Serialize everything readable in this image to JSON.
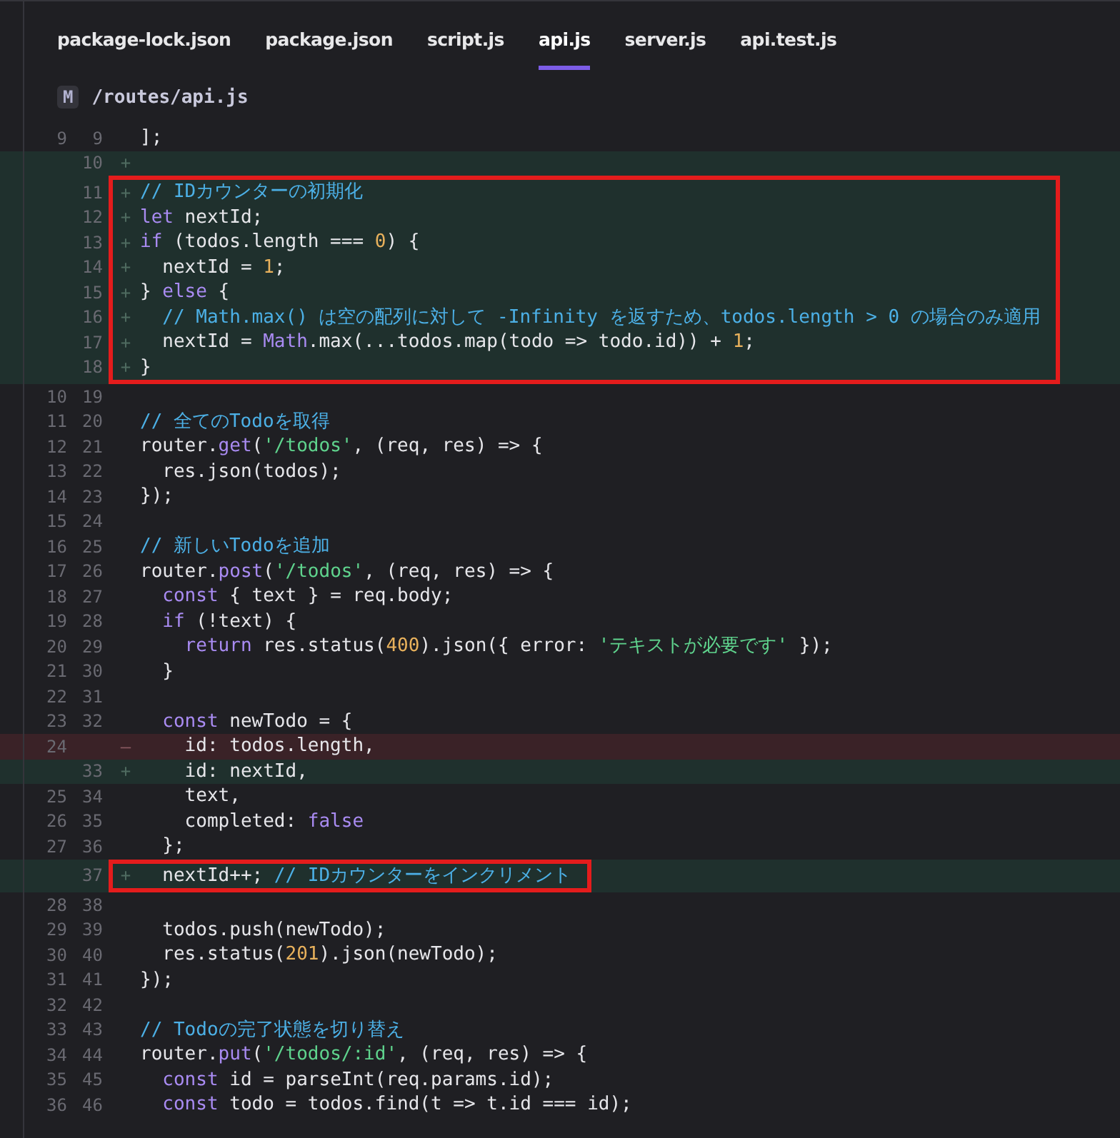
{
  "tabs": [
    {
      "label": "package-lock.json",
      "selected": false
    },
    {
      "label": "package.json",
      "selected": false
    },
    {
      "label": "script.js",
      "selected": false
    },
    {
      "label": "api.js",
      "selected": true
    },
    {
      "label": "server.js",
      "selected": false
    },
    {
      "label": "api.test.js",
      "selected": false
    }
  ],
  "file": {
    "status": "M",
    "path": "/routes/api.js"
  },
  "blocks": [
    {
      "boxed": false,
      "lines": [
        {
          "kind": "context",
          "old": "9",
          "new": "9",
          "tokens": [
            {
              "kind": "plain",
              "text": "];"
            }
          ]
        },
        {
          "kind": "added",
          "new": "10",
          "marker": "+"
        }
      ]
    },
    {
      "boxed": true,
      "lines": [
        {
          "kind": "added",
          "new": "11",
          "marker": "+",
          "tokens": [
            {
              "kind": "comment",
              "text": "// IDカウンターの初期化"
            }
          ]
        },
        {
          "kind": "added",
          "new": "12",
          "marker": "+",
          "tokens": [
            {
              "kind": "keyword",
              "text": "let"
            },
            {
              "kind": "plain",
              "text": " nextId;"
            }
          ]
        },
        {
          "kind": "added",
          "new": "13",
          "marker": "+",
          "tokens": [
            {
              "kind": "keyword",
              "text": "if"
            },
            {
              "kind": "plain",
              "text": " (todos.length === "
            },
            {
              "kind": "number",
              "text": "0"
            },
            {
              "kind": "plain",
              "text": ") {"
            }
          ]
        },
        {
          "kind": "added",
          "new": "14",
          "marker": "+",
          "tokens": [
            {
              "kind": "plain",
              "text": "  nextId = "
            },
            {
              "kind": "number",
              "text": "1"
            },
            {
              "kind": "plain",
              "text": ";"
            }
          ]
        },
        {
          "kind": "added",
          "new": "15",
          "marker": "+",
          "tokens": [
            {
              "kind": "plain",
              "text": "} "
            },
            {
              "kind": "keyword",
              "text": "else"
            },
            {
              "kind": "plain",
              "text": " {"
            }
          ]
        },
        {
          "kind": "added",
          "new": "16",
          "marker": "+",
          "tokens": [
            {
              "kind": "comment",
              "text": "  // Math.max() は空の配列に対して -Infinity を返すため、todos.length > 0 の場合のみ適用"
            }
          ]
        },
        {
          "kind": "added",
          "new": "17",
          "marker": "+",
          "tokens": [
            {
              "kind": "plain",
              "text": "  nextId = "
            },
            {
              "kind": "keyword",
              "text": "Math"
            },
            {
              "kind": "plain",
              "text": ".max(...todos.map(todo => todo.id)) + "
            },
            {
              "kind": "number",
              "text": "1"
            },
            {
              "kind": "plain",
              "text": ";"
            }
          ]
        },
        {
          "kind": "added",
          "new": "18",
          "marker": "+",
          "tokens": [
            {
              "kind": "plain",
              "text": "}"
            }
          ]
        }
      ]
    },
    {
      "boxed": false,
      "lines": [
        {
          "kind": "context",
          "old": "10",
          "new": "19"
        },
        {
          "kind": "context",
          "old": "11",
          "new": "20",
          "tokens": [
            {
              "kind": "comment",
              "text": "// 全てのTodoを取得"
            }
          ]
        },
        {
          "kind": "context",
          "old": "12",
          "new": "21",
          "tokens": [
            {
              "kind": "plain",
              "text": "router."
            },
            {
              "kind": "keyword",
              "text": "get"
            },
            {
              "kind": "plain",
              "text": "("
            },
            {
              "kind": "string",
              "text": "'/todos'"
            },
            {
              "kind": "plain",
              "text": ", (req, res) => {"
            }
          ]
        },
        {
          "kind": "context",
          "old": "13",
          "new": "22",
          "tokens": [
            {
              "kind": "plain",
              "text": "  res.json(todos);"
            }
          ]
        },
        {
          "kind": "context",
          "old": "14",
          "new": "23",
          "tokens": [
            {
              "kind": "plain",
              "text": "});"
            }
          ]
        },
        {
          "kind": "context",
          "old": "15",
          "new": "24"
        },
        {
          "kind": "context",
          "old": "16",
          "new": "25",
          "tokens": [
            {
              "kind": "comment",
              "text": "// 新しいTodoを追加"
            }
          ]
        },
        {
          "kind": "context",
          "old": "17",
          "new": "26",
          "tokens": [
            {
              "kind": "plain",
              "text": "router."
            },
            {
              "kind": "keyword",
              "text": "post"
            },
            {
              "kind": "plain",
              "text": "("
            },
            {
              "kind": "string",
              "text": "'/todos'"
            },
            {
              "kind": "plain",
              "text": ", (req, res) => {"
            }
          ]
        },
        {
          "kind": "context",
          "old": "18",
          "new": "27",
          "tokens": [
            {
              "kind": "keyword",
              "text": "  const"
            },
            {
              "kind": "plain",
              "text": " { text } = req.body;"
            }
          ]
        },
        {
          "kind": "context",
          "old": "19",
          "new": "28",
          "tokens": [
            {
              "kind": "keyword",
              "text": "  if"
            },
            {
              "kind": "plain",
              "text": " (!text) {"
            }
          ]
        },
        {
          "kind": "context",
          "old": "20",
          "new": "29",
          "tokens": [
            {
              "kind": "keyword",
              "text": "    return"
            },
            {
              "kind": "plain",
              "text": " res.status("
            },
            {
              "kind": "number",
              "text": "400"
            },
            {
              "kind": "plain",
              "text": ").json({ error: "
            },
            {
              "kind": "string",
              "text": "'テキストが必要です'"
            },
            {
              "kind": "plain",
              "text": " });"
            }
          ]
        },
        {
          "kind": "context",
          "old": "21",
          "new": "30",
          "tokens": [
            {
              "kind": "plain",
              "text": "  }"
            }
          ]
        },
        {
          "kind": "context",
          "old": "22",
          "new": "31"
        },
        {
          "kind": "context",
          "old": "23",
          "new": "32",
          "tokens": [
            {
              "kind": "keyword",
              "text": "  const"
            },
            {
              "kind": "plain",
              "text": " newTodo = {"
            }
          ]
        },
        {
          "kind": "removed",
          "old": "24",
          "marker": "—",
          "tokens": [
            {
              "kind": "plain",
              "text": "    id: todos.length,"
            }
          ]
        },
        {
          "kind": "added",
          "new": "33",
          "marker": "+",
          "tokens": [
            {
              "kind": "plain",
              "text": "    id: nextId,"
            }
          ]
        },
        {
          "kind": "context",
          "old": "25",
          "new": "34",
          "tokens": [
            {
              "kind": "plain",
              "text": "    text,"
            }
          ]
        },
        {
          "kind": "context",
          "old": "26",
          "new": "35",
          "tokens": [
            {
              "kind": "plain",
              "text": "    completed: "
            },
            {
              "kind": "keyword",
              "text": "false"
            }
          ]
        },
        {
          "kind": "context",
          "old": "27",
          "new": "36",
          "tokens": [
            {
              "kind": "plain",
              "text": "  };"
            }
          ]
        }
      ]
    },
    {
      "boxed": true,
      "lines": [
        {
          "kind": "added",
          "new": "37",
          "marker": "+",
          "tokens": [
            {
              "kind": "plain",
              "text": "  nextId++; "
            },
            {
              "kind": "comment",
              "text": "// IDカウンターをインクリメント"
            }
          ]
        }
      ]
    },
    {
      "boxed": false,
      "lines": [
        {
          "kind": "context",
          "old": "28",
          "new": "38"
        },
        {
          "kind": "context",
          "old": "29",
          "new": "39",
          "tokens": [
            {
              "kind": "plain",
              "text": "  todos.push(newTodo);"
            }
          ]
        },
        {
          "kind": "context",
          "old": "30",
          "new": "40",
          "tokens": [
            {
              "kind": "plain",
              "text": "  res.status("
            },
            {
              "kind": "number",
              "text": "201"
            },
            {
              "kind": "plain",
              "text": ").json(newTodo);"
            }
          ]
        },
        {
          "kind": "context",
          "old": "31",
          "new": "41",
          "tokens": [
            {
              "kind": "plain",
              "text": "});"
            }
          ]
        },
        {
          "kind": "context",
          "old": "32",
          "new": "42"
        },
        {
          "kind": "context",
          "old": "33",
          "new": "43",
          "tokens": [
            {
              "kind": "comment",
              "text": "// Todoの完了状態を切り替え"
            }
          ]
        },
        {
          "kind": "context",
          "old": "34",
          "new": "44",
          "tokens": [
            {
              "kind": "plain",
              "text": "router."
            },
            {
              "kind": "keyword",
              "text": "put"
            },
            {
              "kind": "plain",
              "text": "("
            },
            {
              "kind": "string",
              "text": "'/todos/:id'"
            },
            {
              "kind": "plain",
              "text": ", (req, res) => {"
            }
          ]
        },
        {
          "kind": "context",
          "old": "35",
          "new": "45",
          "tokens": [
            {
              "kind": "keyword",
              "text": "  const"
            },
            {
              "kind": "plain",
              "text": " id = parseInt(req.params.id);"
            }
          ]
        },
        {
          "kind": "context",
          "old": "36",
          "new": "46",
          "tokens": [
            {
              "kind": "keyword",
              "text": "  const"
            },
            {
              "kind": "plain",
              "text": " todo = todos.find(t => t.id === id);"
            }
          ]
        }
      ]
    }
  ]
}
